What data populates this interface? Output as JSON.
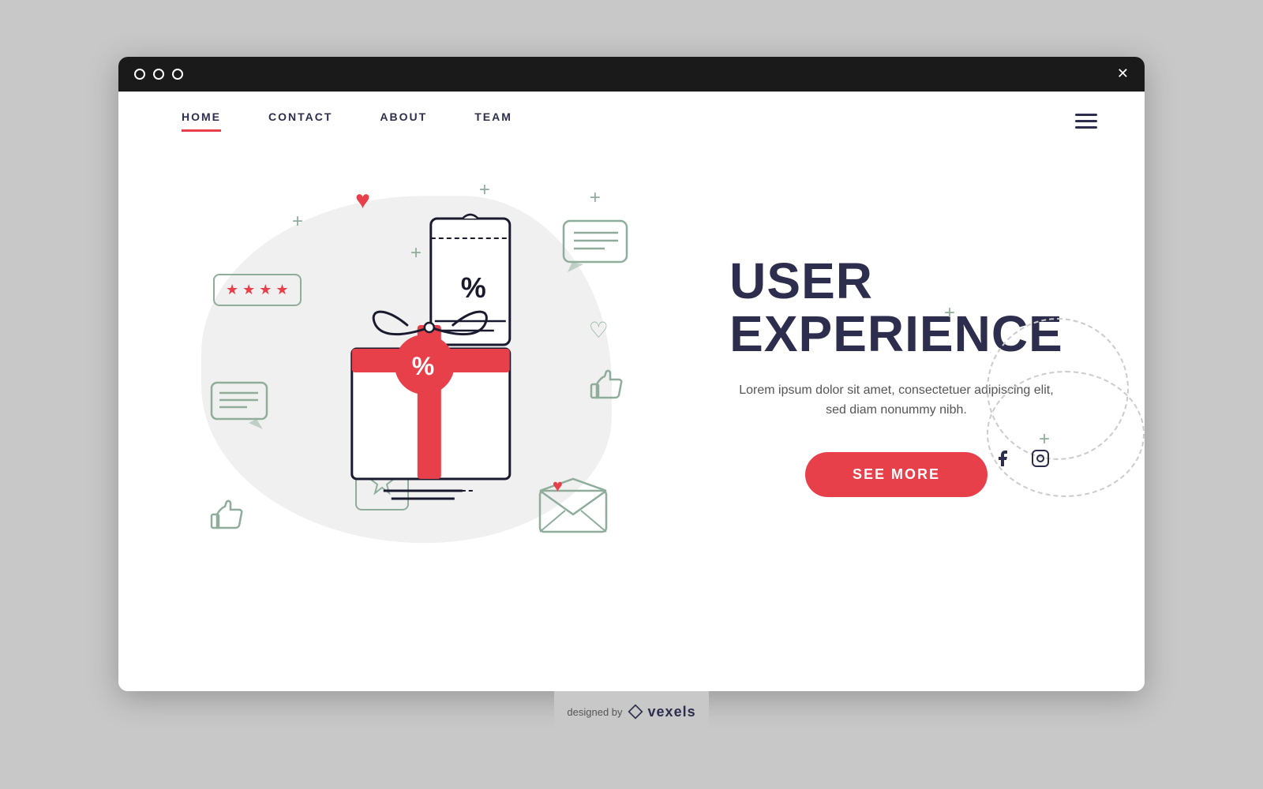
{
  "browser": {
    "dots": [
      "dot1",
      "dot2",
      "dot3"
    ],
    "close": "✕"
  },
  "nav": {
    "links": [
      {
        "label": "HOME",
        "active": true
      },
      {
        "label": "CONTACT",
        "active": false
      },
      {
        "label": "ABOUT",
        "active": false
      },
      {
        "label": "TEAM",
        "active": false
      }
    ]
  },
  "hero": {
    "heading_line1": "USER",
    "heading_line2": "EXPERIENCE",
    "description": "Lorem ipsum dolor sit amet, consectetuer adipiscing elit, sed diam nonummy nibh.",
    "cta_label": "SEE MORE"
  },
  "social": {
    "facebook": "f",
    "instagram": "instagram"
  },
  "footer": {
    "designed_by": "designed by",
    "brand": "vexels"
  },
  "decorative": {
    "heart": "♥",
    "plus": "+",
    "percent": "%"
  }
}
